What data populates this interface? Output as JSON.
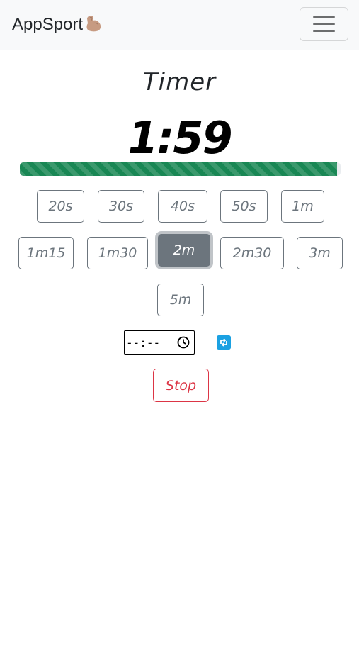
{
  "navbar": {
    "brand": "AppSport",
    "brand_icon": "flexed-biceps-icon",
    "toggler_icon": "hamburger-menu-icon"
  },
  "timer": {
    "title": "Timer",
    "time_display": "1:59",
    "progress_fraction": 0.99,
    "progress_color": "#198754"
  },
  "presets": [
    {
      "label": "20s",
      "active": false
    },
    {
      "label": "30s",
      "active": false
    },
    {
      "label": "40s",
      "active": false
    },
    {
      "label": "50s",
      "active": false
    },
    {
      "label": "1m",
      "active": false
    },
    {
      "label": "1m15",
      "active": false
    },
    {
      "label": "1m30",
      "active": false
    },
    {
      "label": "2m",
      "active": true
    },
    {
      "label": "2m30",
      "active": false
    },
    {
      "label": "3m",
      "active": false
    },
    {
      "label": "5m",
      "active": false
    }
  ],
  "custom_time": {
    "value": "--:--",
    "icon": "clock-icon",
    "refresh_icon": "refresh-icon"
  },
  "actions": {
    "stop_label": "Stop",
    "stop_color": "#dc3545"
  },
  "colors": {
    "secondary": "#6c757d",
    "navbar_bg": "#f8f9fa"
  }
}
